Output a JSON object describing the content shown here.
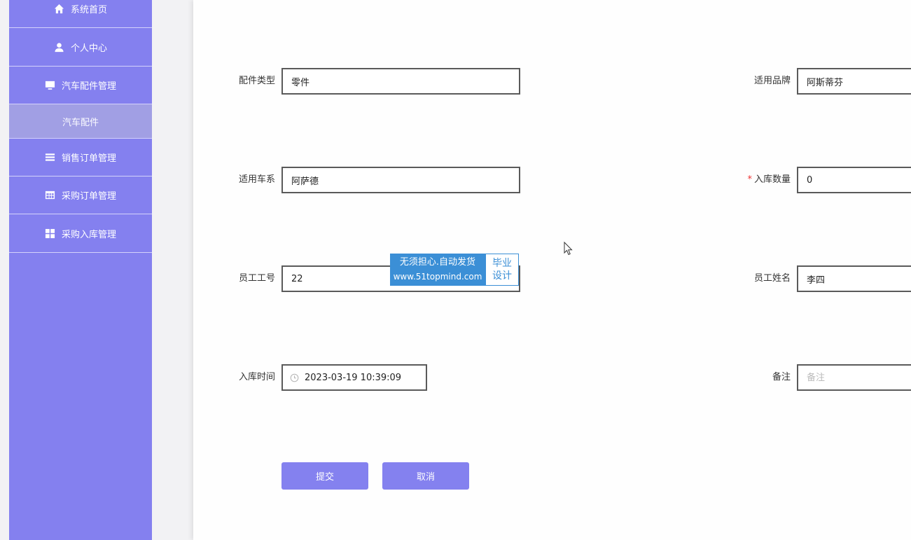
{
  "sidebar": {
    "items": [
      {
        "label": "系统首页",
        "icon": "home-icon"
      },
      {
        "label": "个人中心",
        "icon": "user-icon"
      },
      {
        "label": "汽车配件管理",
        "icon": "monitor-icon"
      },
      {
        "label": "汽车配件",
        "icon": ""
      },
      {
        "label": "销售订单管理",
        "icon": "list-icon"
      },
      {
        "label": "采购订单管理",
        "icon": "table-icon"
      },
      {
        "label": "采购入库管理",
        "icon": "grid-icon"
      }
    ]
  },
  "form": {
    "part_type": {
      "label": "配件类型",
      "value": "零件"
    },
    "brand": {
      "label": "适用品牌",
      "value": "阿斯蒂芬"
    },
    "series": {
      "label": "适用车系",
      "value": "阿萨德"
    },
    "quantity": {
      "label": "入库数量",
      "required_mark": "*",
      "value": "0"
    },
    "employee_no": {
      "label": "员工工号",
      "value": "22"
    },
    "employee_name": {
      "label": "员工姓名",
      "value": "李四"
    },
    "time": {
      "label": "入库时间",
      "value": "2023-03-19 10:39:09"
    },
    "remark": {
      "label": "备注",
      "placeholder": "备注",
      "value": ""
    }
  },
  "buttons": {
    "submit": "提交",
    "cancel": "取消"
  },
  "watermark": {
    "line1": "无须担心.自动发货",
    "line2": "www.51topmind.com",
    "badge1": "毕业",
    "badge2": "设计"
  },
  "colors": {
    "sidebar": "#8480ef",
    "button": "#8481ef",
    "watermark": "#3b8fd6"
  }
}
